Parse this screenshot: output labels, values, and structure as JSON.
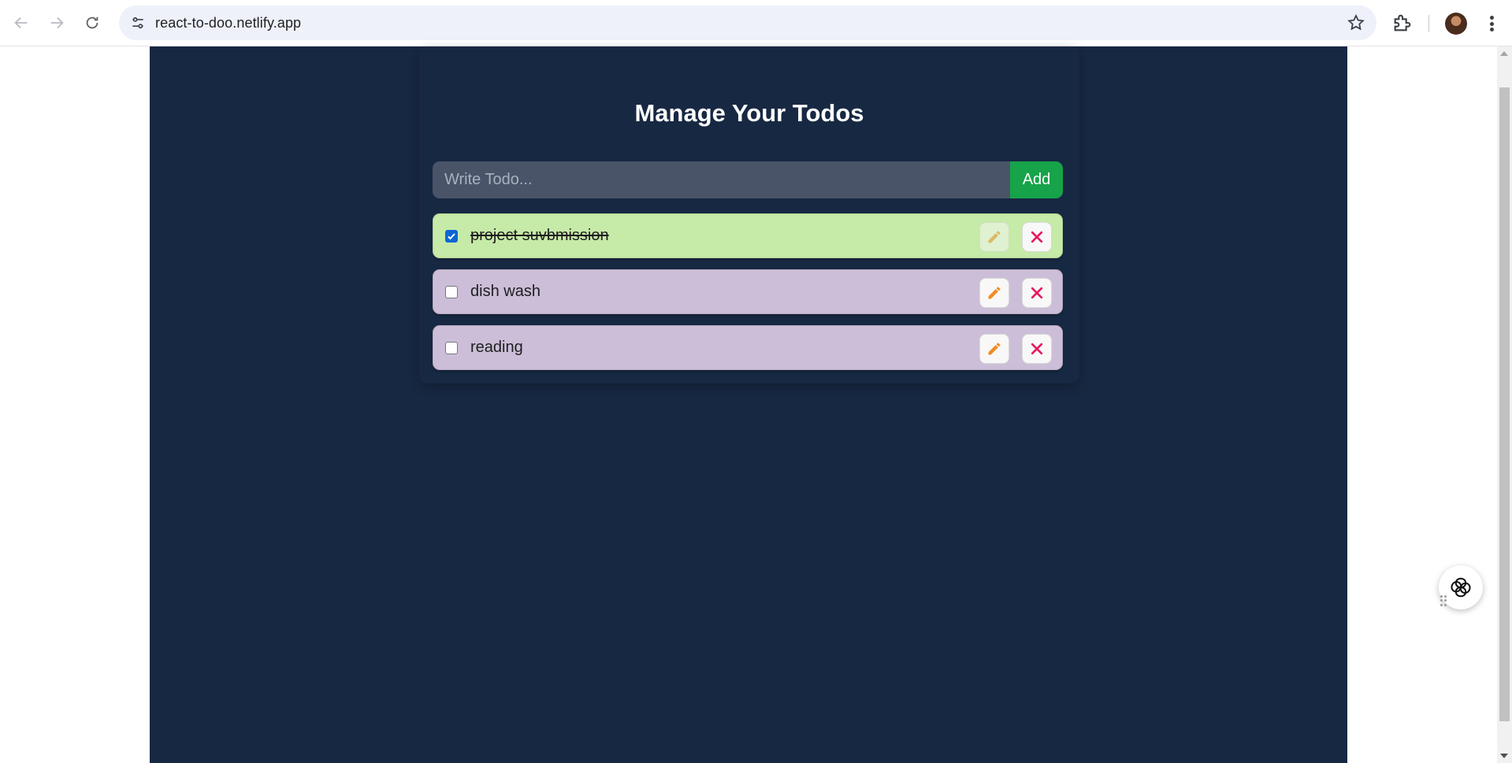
{
  "browser": {
    "url": "react-to-doo.netlify.app",
    "icons": {
      "back": "arrow-left-icon",
      "forward": "arrow-right-icon",
      "reload": "reload-icon",
      "site_info": "tune-icon",
      "bookmark": "star-icon",
      "extensions": "puzzle-icon",
      "menu": "kebab-menu-icon"
    }
  },
  "app": {
    "title": "Manage Your Todos",
    "form": {
      "placeholder": "Write Todo...",
      "value": "",
      "add_label": "Add"
    },
    "todos": [
      {
        "text": "project suvbmission",
        "completed": true
      },
      {
        "text": "dish wash",
        "completed": false
      },
      {
        "text": "reading",
        "completed": false
      }
    ],
    "colors": {
      "background": "#172842",
      "completed_row": "#c6eaa8",
      "open_row": "#ccbed8",
      "add_button": "#17a34a",
      "input_bg": "#495469",
      "edit_icon": "#f28b22",
      "delete_icon": "#e5195e"
    }
  },
  "widget": {
    "icon": "ai-assistant-icon"
  }
}
